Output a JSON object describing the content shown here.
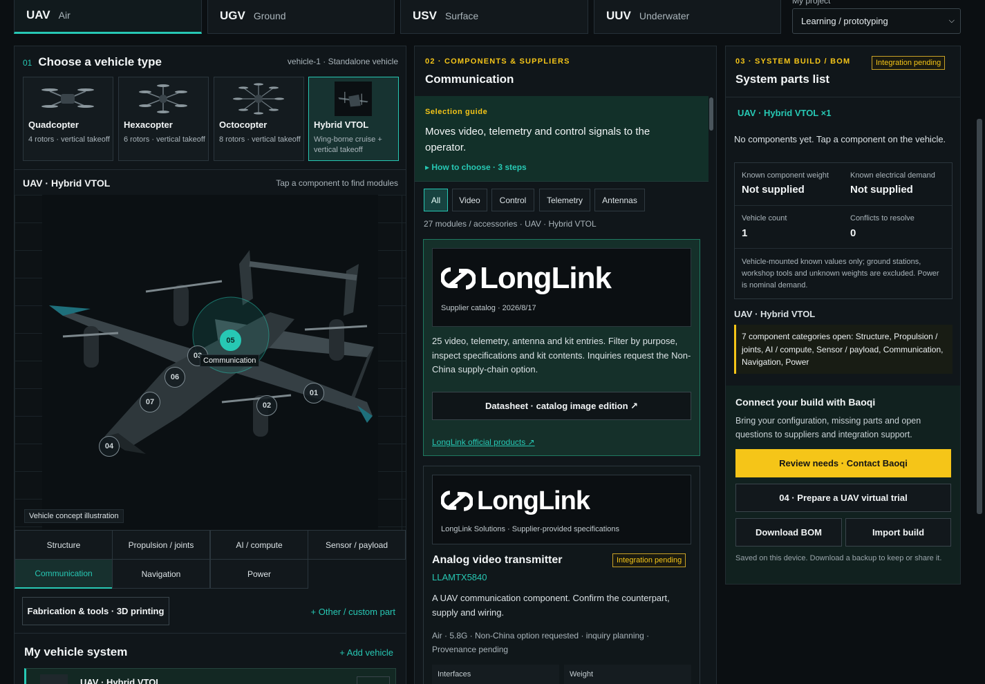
{
  "vehicle_tabs": [
    {
      "code": "UAV",
      "name": "Air"
    },
    {
      "code": "UGV",
      "name": "Ground"
    },
    {
      "code": "USV",
      "name": "Surface"
    },
    {
      "code": "UUV",
      "name": "Underwater"
    }
  ],
  "project": {
    "label": "My project",
    "selected": "Learning / prototyping"
  },
  "choose": {
    "num": "01",
    "title": "Choose a vehicle type",
    "meta": "vehicle-1 · Standalone vehicle",
    "cards": [
      {
        "title": "Quadcopter",
        "desc": "4 rotors · vertical takeoff"
      },
      {
        "title": "Hexacopter",
        "desc": "6 rotors · vertical takeoff"
      },
      {
        "title": "Octocopter",
        "desc": "8 rotors · vertical takeoff"
      },
      {
        "title": "Hybrid VTOL",
        "desc": "Wing-borne cruise + vertical takeoff"
      }
    ]
  },
  "viewer": {
    "title": "UAV · Hybrid VTOL",
    "hint": "Tap a component to find modules",
    "caption": "Vehicle concept illustration",
    "selected_marker": "05",
    "selected_label": "Communication",
    "markers": [
      "01",
      "02",
      "03",
      "04",
      "06",
      "07"
    ]
  },
  "categories": [
    "Structure",
    "Propulsion / joints",
    "AI / compute",
    "Sensor / payload",
    "Communication",
    "Navigation",
    "Power"
  ],
  "tools": {
    "fabrication": "Fabrication & tools · 3D printing",
    "custom": "+ Other / custom part"
  },
  "my_system": {
    "title": "My vehicle system",
    "add": "+ Add vehicle",
    "row": "UAV · Hybrid VTOL"
  },
  "components": {
    "kicker": "02 · COMPONENTS & SUPPLIERS",
    "title": "Communication",
    "guide_kicker": "Selection guide",
    "guide_text": "Moves video, telemetry and control signals to the operator.",
    "guide_link": "▸ How to choose · 3 steps",
    "filters": [
      "All",
      "Video",
      "Control",
      "Telemetry",
      "Antennas"
    ],
    "count": "27 modules / accessories · UAV · Hybrid VTOL",
    "card1": {
      "logo": "LongLink",
      "sub": "Supplier catalog · 2026/8/17",
      "desc": "25 video, telemetry, antenna and kit entries. Filter by purpose, inspect specifications and kit contents. Inquiries request the Non-China supply-chain option.",
      "button": "Datasheet · catalog image edition ↗",
      "link": "LongLink official products ↗"
    },
    "card2": {
      "logo": "LongLink",
      "sub": "LongLink Solutions · Supplier-provided specifications",
      "title": "Analog video transmitter",
      "badge": "Integration pending",
      "part": "LLAMTX5840",
      "desc": "A UAV communication component. Confirm the counterpart, supply and wiring.",
      "meta": "Air · 5.8G · Non-China option requested · inquiry planning · Provenance pending",
      "interfaces_label": "Interfaces",
      "weight_label": "Weight"
    }
  },
  "bom": {
    "kicker": "03 · SYSTEM BUILD / BOM",
    "badge": "Integration pending",
    "title": "System parts list",
    "vehicle": "UAV · Hybrid VTOL ×1",
    "empty": "No components yet. Tap a component on the vehicle.",
    "stats": [
      {
        "label": "Known component weight",
        "value": "Not supplied"
      },
      {
        "label": "Known electrical demand",
        "value": "Not supplied"
      },
      {
        "label": "Vehicle count",
        "value": "1"
      },
      {
        "label": "Conflicts to resolve",
        "value": "0"
      }
    ],
    "note": "Vehicle-mounted known values only; ground stations, workshop tools and unknown weights are excluded. Power is nominal demand.",
    "section": "UAV · Hybrid VTOL",
    "open_categories": "7 component categories open: Structure, Propulsion / joints, AI / compute, Sensor / payload, Communication, Navigation, Power"
  },
  "connect": {
    "title": "Connect your build with Baoqi",
    "text": "Bring your configuration, missing parts and open questions to suppliers and integration support.",
    "primary": "Review needs · Contact Baoqi",
    "trial": "04 · Prepare a UAV virtual trial",
    "download": "Download BOM",
    "import": "Import build",
    "saved": "Saved on this device. Download a backup to keep or share it."
  },
  "colors": {
    "accent": "#27c8b4",
    "warning": "#f5c518",
    "bg": "#0b0f12"
  }
}
